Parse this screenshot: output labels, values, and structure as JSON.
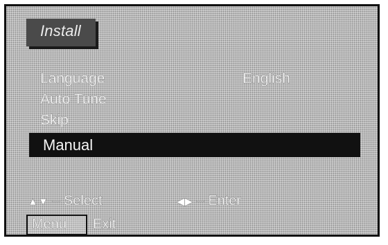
{
  "title": "Install",
  "menu": {
    "items": [
      {
        "label": "Language",
        "value": "English"
      },
      {
        "label": "Auto Tune"
      },
      {
        "label": "Skip"
      },
      {
        "label": "Manual"
      }
    ],
    "selected_index": 3
  },
  "hints": {
    "select_symbols": "▲▼",
    "select_text": "– Select",
    "enter_symbols": "◀▶",
    "enter_text": "– Enter",
    "menu_key": "Menu",
    "exit_text": "Exit"
  },
  "colors": {
    "background": "#bdbdbd",
    "highlight": "#111111",
    "title_box": "#4a4a4a"
  }
}
